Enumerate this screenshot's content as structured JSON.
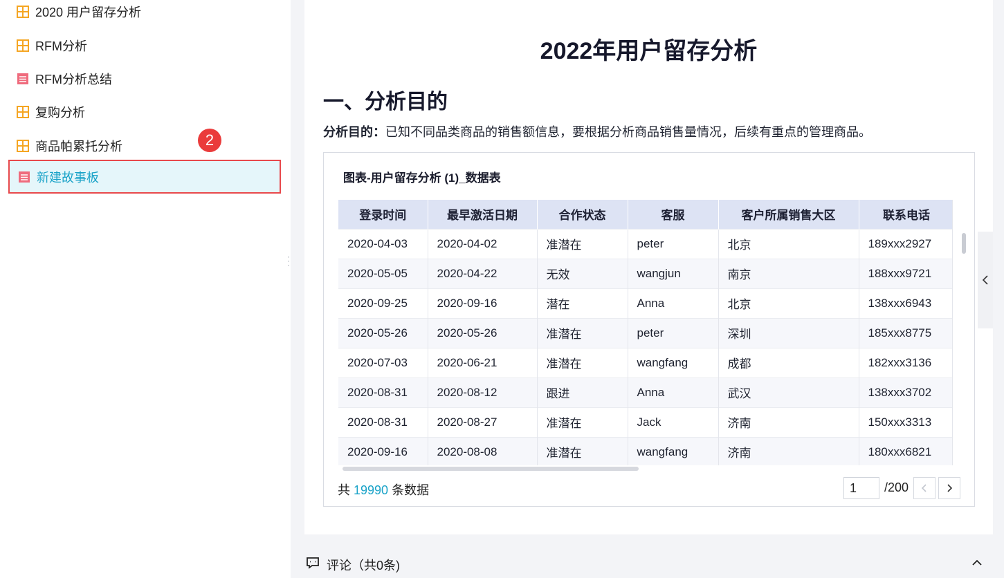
{
  "sidebar": {
    "items": [
      {
        "label": "2020 用户留存分析",
        "icon": "dashboard-icon",
        "active": false
      },
      {
        "label": "RFM分析",
        "icon": "dashboard-icon",
        "active": false
      },
      {
        "label": "RFM分析总结",
        "icon": "story-icon",
        "active": false
      },
      {
        "label": "复购分析",
        "icon": "dashboard-icon",
        "active": false
      },
      {
        "label": "商品帕累托分析",
        "icon": "dashboard-icon",
        "active": false
      },
      {
        "label": "新建故事板",
        "icon": "story-icon",
        "active": true
      }
    ],
    "badge": "2"
  },
  "doc": {
    "title": "2022年用户留存分析",
    "section_title": "一、分析目的",
    "purpose_label": "分析目的：",
    "purpose_text": "已知不同品类商品的销售额信息，要根据分析商品销售量情况，后续有重点的管理商品。"
  },
  "table": {
    "title": "图表-用户留存分析 (1)_数据表",
    "columns": [
      "登录时间",
      "最早激活日期",
      "合作状态",
      "客服",
      "客户所属销售大区",
      "联系电话"
    ],
    "rows": [
      [
        "2020-04-03",
        "2020-04-02",
        "准潜在",
        "peter",
        "北京",
        "189xxx2927"
      ],
      [
        "2020-05-05",
        "2020-04-22",
        "无效",
        "wangjun",
        "南京",
        "188xxx9721"
      ],
      [
        "2020-09-25",
        "2020-09-16",
        "潜在",
        "Anna",
        "北京",
        "138xxx6943"
      ],
      [
        "2020-05-26",
        "2020-05-26",
        "准潜在",
        "peter",
        "深圳",
        "185xxx8775"
      ],
      [
        "2020-07-03",
        "2020-06-21",
        "准潜在",
        "wangfang",
        "成都",
        "182xxx3136"
      ],
      [
        "2020-08-31",
        "2020-08-12",
        "跟进",
        "Anna",
        "武汉",
        "138xxx3702"
      ],
      [
        "2020-08-31",
        "2020-08-27",
        "准潜在",
        "Jack",
        "济南",
        "150xxx3313"
      ],
      [
        "2020-09-16",
        "2020-08-08",
        "准潜在",
        "wangfang",
        "济南",
        "180xxx6821"
      ]
    ],
    "total_prefix": "共",
    "total_count": "19990",
    "total_suffix": "条数据",
    "page_current": "1",
    "page_total": "/200"
  },
  "comments": {
    "label": "评论（共0条)"
  },
  "colors": {
    "accent": "#1aa3c8",
    "highlight_border": "#e8484b",
    "badge": "#ea3b3b",
    "dashboard_icon": "#f5a623",
    "story_icon": "#ef6b7d"
  }
}
